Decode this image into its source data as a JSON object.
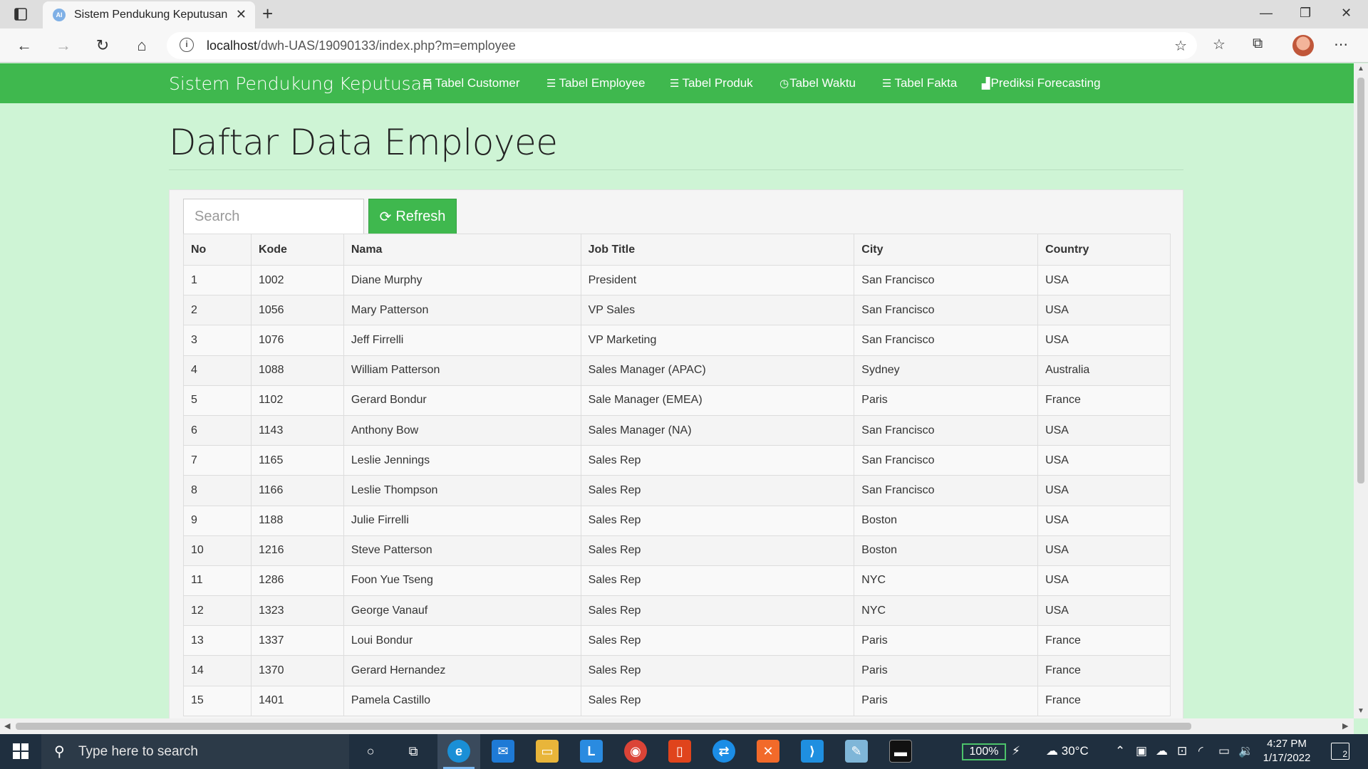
{
  "browser": {
    "tab_title": "Sistem Pendukung Keputusan",
    "tab_favicon_text": "AI",
    "url_host": "localhost",
    "url_path": "/dwh-UAS/19090133/index.php?m=employee"
  },
  "navbar": {
    "brand": "Sistem Pendukung Keputusan",
    "items": [
      {
        "label": "Tabel Customer",
        "icon": "list-icon"
      },
      {
        "label": "Tabel Employee",
        "icon": "list-icon"
      },
      {
        "label": "Tabel Produk",
        "icon": "list-icon"
      },
      {
        "label": "Tabel Waktu",
        "icon": "clock-icon"
      },
      {
        "label": "Tabel Fakta",
        "icon": "list-icon"
      },
      {
        "label": "Prediksi Forecasting",
        "icon": "bar-chart-icon"
      }
    ]
  },
  "page": {
    "title": "Daftar Data Employee"
  },
  "toolbar": {
    "search_placeholder": "Search",
    "refresh_label": "Refresh"
  },
  "table": {
    "headers": [
      "No",
      "Kode",
      "Nama",
      "Job Title",
      "City",
      "Country"
    ],
    "rows": [
      [
        "1",
        "1002",
        "Diane Murphy",
        "President",
        "San Francisco",
        "USA"
      ],
      [
        "2",
        "1056",
        "Mary Patterson",
        "VP Sales",
        "San Francisco",
        "USA"
      ],
      [
        "3",
        "1076",
        "Jeff Firrelli",
        "VP Marketing",
        "San Francisco",
        "USA"
      ],
      [
        "4",
        "1088",
        "William Patterson",
        "Sales Manager (APAC)",
        "Sydney",
        "Australia"
      ],
      [
        "5",
        "1102",
        "Gerard Bondur",
        "Sale Manager (EMEA)",
        "Paris",
        "France"
      ],
      [
        "6",
        "1143",
        "Anthony Bow",
        "Sales Manager (NA)",
        "San Francisco",
        "USA"
      ],
      [
        "7",
        "1165",
        "Leslie Jennings",
        "Sales Rep",
        "San Francisco",
        "USA"
      ],
      [
        "8",
        "1166",
        "Leslie Thompson",
        "Sales Rep",
        "San Francisco",
        "USA"
      ],
      [
        "9",
        "1188",
        "Julie Firrelli",
        "Sales Rep",
        "Boston",
        "USA"
      ],
      [
        "10",
        "1216",
        "Steve Patterson",
        "Sales Rep",
        "Boston",
        "USA"
      ],
      [
        "11",
        "1286",
        "Foon Yue Tseng",
        "Sales Rep",
        "NYC",
        "USA"
      ],
      [
        "12",
        "1323",
        "George Vanauf",
        "Sales Rep",
        "NYC",
        "USA"
      ],
      [
        "13",
        "1337",
        "Loui Bondur",
        "Sales Rep",
        "Paris",
        "France"
      ],
      [
        "14",
        "1370",
        "Gerard Hernandez",
        "Sales Rep",
        "Paris",
        "France"
      ],
      [
        "15",
        "1401",
        "Pamela Castillo",
        "Sales Rep",
        "Paris",
        "France"
      ]
    ]
  },
  "taskbar": {
    "search_text": "Type here to search",
    "battery": "100%",
    "weather": "30°C",
    "time": "4:27 PM",
    "date": "1/17/2022",
    "notification_count": "2"
  },
  "colors": {
    "navbar_green": "#3fb84e",
    "page_bg": "#cef4d5",
    "taskbar_bg": "#1f2f3f"
  }
}
